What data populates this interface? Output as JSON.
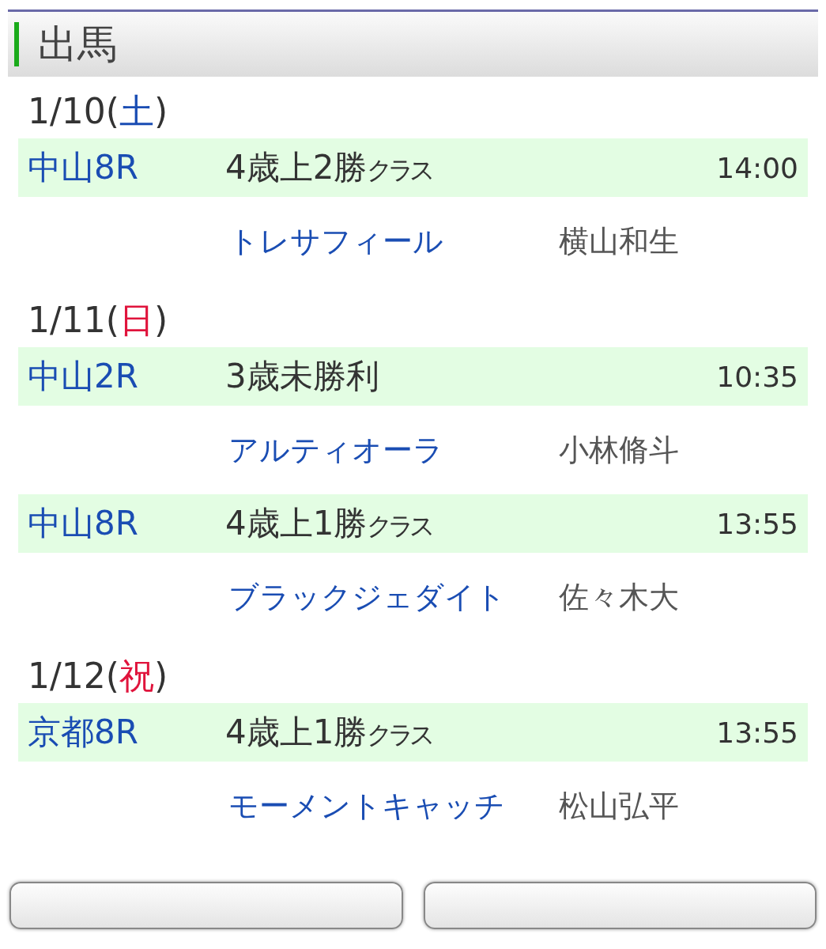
{
  "header": {
    "title": "出馬"
  },
  "days": [
    {
      "date": "1/10(",
      "day": "土",
      "color": "#1a4db3",
      "close": ")",
      "races": [
        {
          "venue": "中山8R",
          "race": "4歳上2勝",
          "race_suffix": "クラス",
          "time": "14:00",
          "horse": "トレサフィール",
          "jockey": "横山和生"
        }
      ]
    },
    {
      "date": "1/11(",
      "day": "日",
      "color": "#e0143c",
      "close": ")",
      "races": [
        {
          "venue": "中山2R",
          "race": "3歳未勝利",
          "time": "10:35",
          "horse": "アルティオーラ",
          "jockey": "小林脩斗"
        },
        {
          "venue": "中山8R",
          "race": "4歳上1勝",
          "race_suffix": "クラス",
          "time": "13:55",
          "horse": "ブラックジェダイト",
          "jockey": "佐々木大"
        }
      ]
    },
    {
      "date": "1/12(",
      "day": "祝",
      "color": "#e0143c",
      "close": ")",
      "races": [
        {
          "venue": "京都8R",
          "race": "4歳上1勝",
          "race_suffix": "クラス",
          "time": "13:55",
          "horse": "モーメントキャッチ",
          "jockey": "松山弘平"
        }
      ]
    }
  ],
  "buttons": [
    {
      "kind": "blank"
    },
    {
      "kind": "blank"
    }
  ]
}
